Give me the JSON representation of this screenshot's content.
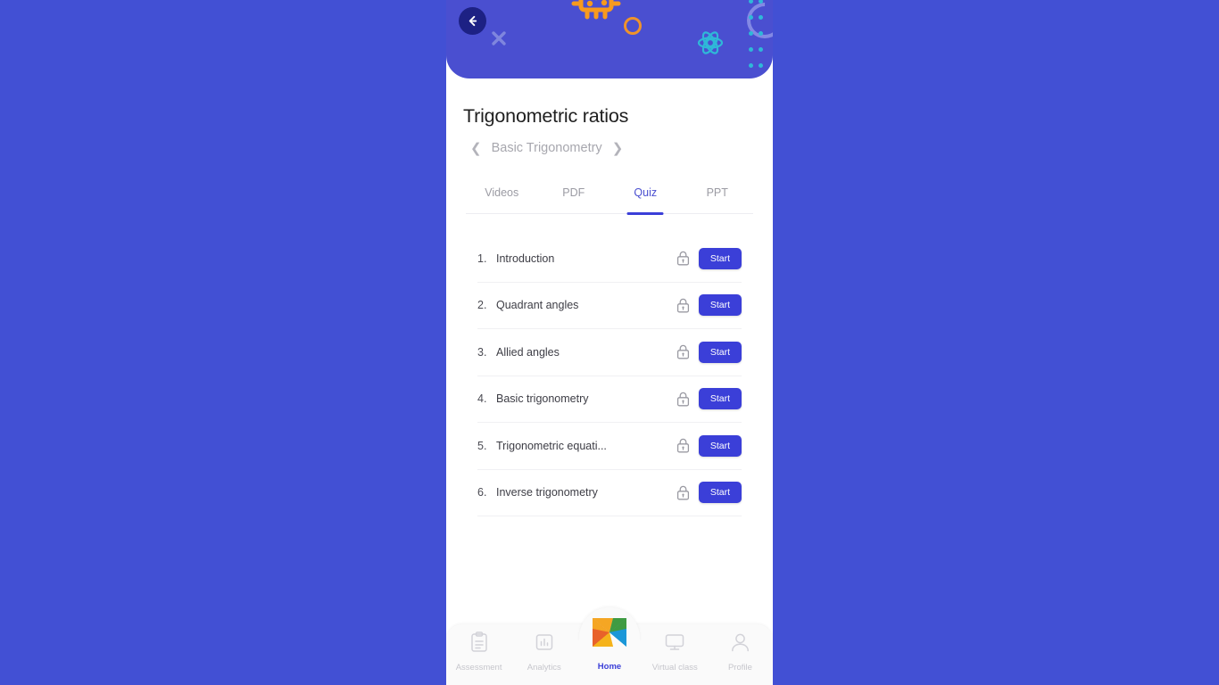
{
  "theme": {
    "page_background": "#4250d4",
    "header_background": "#4a4fd0",
    "accent": "#3b3fd8",
    "back_button_background": "#1d2184",
    "decor_orange": "#f0932b",
    "decor_cyan": "#2fb8d8",
    "text_primary": "#1f1f1f",
    "text_muted": "#a7a7ae"
  },
  "header": {
    "back_button_label": "Back",
    "decorations": [
      "triangle-shape",
      "microchip-icon",
      "brain-icon",
      "circle-outline-shape",
      "x-mark-shape",
      "atom-icon",
      "arc-shape",
      "dot-grid-shape",
      "zigzag-shape"
    ]
  },
  "page": {
    "title": "Trigonometric ratios",
    "breadcrumb": {
      "prev_icon": "❮",
      "label": "Basic Trigonometry",
      "next_icon": "❯"
    }
  },
  "tabs": [
    {
      "label": "Videos",
      "active": false
    },
    {
      "label": "PDF",
      "active": false
    },
    {
      "label": "Quiz",
      "active": true
    },
    {
      "label": "PPT",
      "active": false
    }
  ],
  "quiz_list": {
    "action_label": "Start",
    "items": [
      {
        "number": "1.",
        "title": "Introduction",
        "locked": true,
        "action": "Start"
      },
      {
        "number": "2.",
        "title": "Quadrant angles",
        "locked": true,
        "action": "Start"
      },
      {
        "number": "3.",
        "title": "Allied angles",
        "locked": true,
        "action": "Start"
      },
      {
        "number": "4.",
        "title": "Basic trigonometry",
        "locked": true,
        "action": "Start"
      },
      {
        "number": "5.",
        "title": "Trigonometric equati...",
        "locked": true,
        "action": "Start"
      },
      {
        "number": "6.",
        "title": "Inverse trigonometry",
        "locked": true,
        "action": "Start"
      }
    ]
  },
  "bottom_nav": {
    "items": [
      {
        "label": "Assessment",
        "icon": "clipboard-icon",
        "active": false
      },
      {
        "label": "Analytics",
        "icon": "bar-chart-icon",
        "active": false
      },
      {
        "label": "Home",
        "icon": "app-logo-icon",
        "active": true
      },
      {
        "label": "Virtual class",
        "icon": "monitor-icon",
        "active": false
      },
      {
        "label": "Profile",
        "icon": "person-icon",
        "active": false
      }
    ]
  }
}
